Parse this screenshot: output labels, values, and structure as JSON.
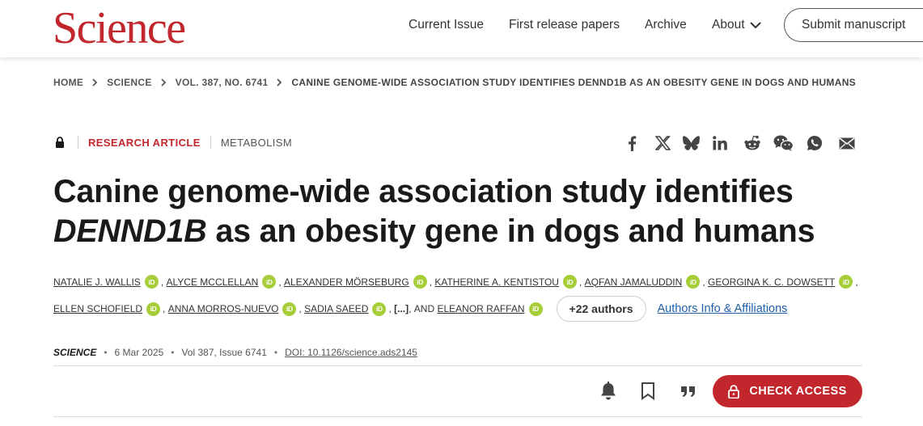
{
  "header": {
    "logo": "Science",
    "nav": [
      {
        "label": "Current Issue"
      },
      {
        "label": "First release papers"
      },
      {
        "label": "Archive"
      },
      {
        "label": "About"
      }
    ],
    "submit_label": "Submit manuscript"
  },
  "breadcrumb": [
    "HOME",
    "SCIENCE",
    "VOL. 387, NO. 6741",
    "CANINE GENOME-WIDE ASSOCIATION STUDY IDENTIFIES DENND1B AS AN OBESITY GENE IN DOGS AND HUMANS"
  ],
  "article": {
    "type": "RESEARCH ARTICLE",
    "subject": "METABOLISM",
    "title_part1": "Canine genome-wide association study identifies ",
    "title_gene": "DENND1B",
    "title_part2": " as an obesity gene in dogs and humans",
    "authors_row1": [
      "NATALIE J. WALLIS",
      "ALYCE MCCLELLAN",
      "ALEXANDER MÖRSEBURG",
      "KATHERINE A. KENTISTOU",
      "AQFAN JAMALUDDIN",
      "GEORGINA K. C. DOWSETT"
    ],
    "authors_row2": [
      "ELLEN SCHOFIELD",
      "ANNA MORROS-NUEVO",
      "SADIA SAEED"
    ],
    "ellipsis": "[...]",
    "and_label": "AND",
    "last_author": "ELEANOR RAFFAN",
    "more_authors": "+22 authors",
    "affiliations_link": "Authors Info & Affiliations",
    "orcid_label": "iD",
    "journal": "SCIENCE",
    "date": "6 Mar 2025",
    "volume": "Vol 387, Issue 6741",
    "doi": "DOI: 10.1126/science.ads2145",
    "access_label": "CHECK ACCESS"
  },
  "share_icons": [
    "facebook-icon",
    "x-icon",
    "bluesky-icon",
    "linkedin-icon",
    "reddit-icon",
    "wechat-icon",
    "whatsapp-icon",
    "email-icon"
  ],
  "colors": {
    "brand": "#c1272d",
    "orcid": "#a6ce39",
    "link": "#1f5fa8"
  }
}
